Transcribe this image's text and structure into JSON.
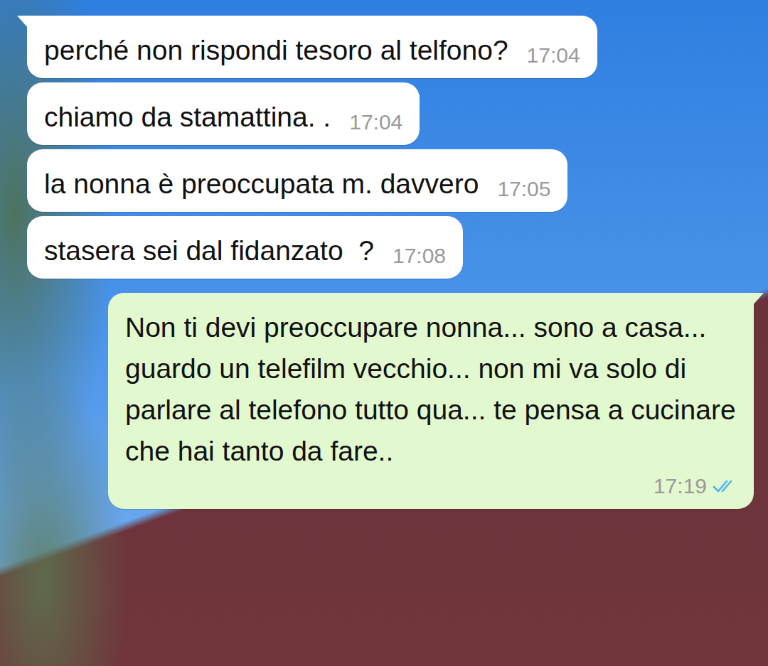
{
  "chat": {
    "messages": [
      {
        "kind": "incoming",
        "text": "perché non rispondi tesoro al telfono?",
        "time": "17:04"
      },
      {
        "kind": "incoming",
        "text": "chiamo da stamattina. .",
        "time": "17:04"
      },
      {
        "kind": "incoming",
        "text": "la nonna è preoccupata m. davvero",
        "time": "17:05"
      },
      {
        "kind": "incoming",
        "text": "stasera sei dal fidanzato  ?",
        "time": "17:08"
      },
      {
        "kind": "outgoing",
        "text": "Non ti devi preoccupare nonna... sono a casa... guardo un telefilm vecchio... non mi va solo di parlare al telefono tutto qua... te pensa a cucinare che hai tanto da fare..",
        "time": "17:19",
        "read": true
      }
    ]
  }
}
